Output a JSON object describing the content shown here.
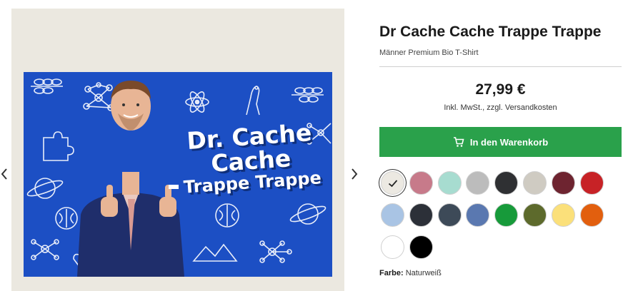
{
  "product": {
    "title": "Dr Cache Cache Trappe Trappe",
    "subtitle": "Männer Premium Bio T-Shirt",
    "price": "27,99 €",
    "tax_note": "Inkl. MwSt., zzgl. Versandkosten",
    "cart_button_label": "In den Warenkorb"
  },
  "print": {
    "line1": "Dr. Cache",
    "line2": "Cache",
    "line3": "Trappe Trappe"
  },
  "colors": {
    "label": "Farbe:",
    "selected_name": "Naturweiß",
    "accent_button": "#2aa14b",
    "print_background": "#1c4fc4",
    "swatches": [
      {
        "name": "Naturweiß",
        "hex": "#ece9e2",
        "selected": true
      },
      {
        "name": "rosa",
        "hex": "#c77a8a"
      },
      {
        "name": "mint",
        "hex": "#a7dcd0"
      },
      {
        "name": "hellgrau",
        "hex": "#bcbcbc"
      },
      {
        "name": "anthrazit",
        "hex": "#2f3033"
      },
      {
        "name": "beige",
        "hex": "#cfcbc2"
      },
      {
        "name": "bordeaux",
        "hex": "#6e2430"
      },
      {
        "name": "rot",
        "hex": "#c72226"
      },
      {
        "name": "hellblau",
        "hex": "#a9c4e4"
      },
      {
        "name": "dunkelgrau",
        "hex": "#2c3038"
      },
      {
        "name": "petrol",
        "hex": "#3d4a58"
      },
      {
        "name": "blau",
        "hex": "#5a78b0"
      },
      {
        "name": "grün",
        "hex": "#179a3a"
      },
      {
        "name": "oliv",
        "hex": "#5d6a2c"
      },
      {
        "name": "gelb",
        "hex": "#fbe07a"
      },
      {
        "name": "orange",
        "hex": "#e25f0e"
      },
      {
        "name": "weiß",
        "hex": "#ffffff"
      },
      {
        "name": "schwarz",
        "hex": "#000000"
      }
    ]
  },
  "icons": {
    "gallery_prev": "chevron-left-icon",
    "gallery_next": "chevron-right-icon",
    "cart": "shopping-cart-icon",
    "selected_swatch": "check-icon"
  }
}
